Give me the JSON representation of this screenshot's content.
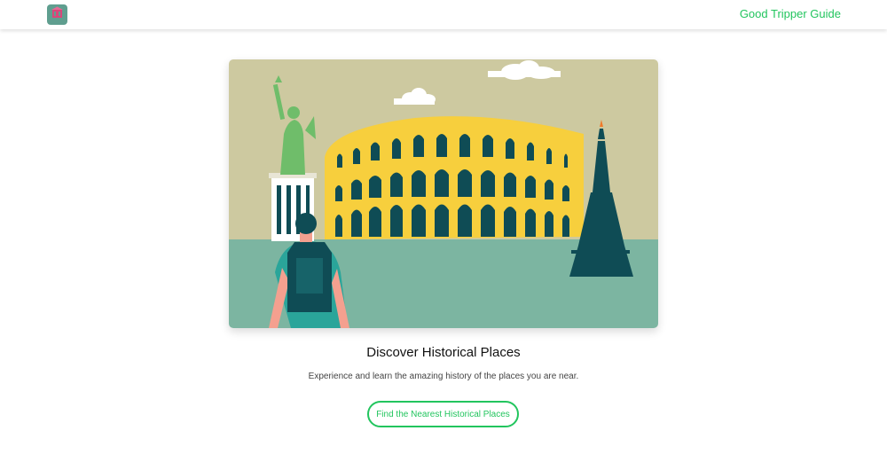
{
  "navbar": {
    "logo_icon": "landmark-logo-icon",
    "brand_label": "Good Tripper Guide"
  },
  "hero": {
    "image_icon": "historical-places-illustration",
    "colors": {
      "sky": "#cdc9a0",
      "ground": "#7cb5a1",
      "colosseum": "#f7cf3d",
      "dark": "#0f4c55",
      "statue": "#6fbd6a",
      "cloud": "#ffffff"
    }
  },
  "main": {
    "title": "Discover Historical Places",
    "subtitle": "Experience and learn the amazing history of the places you are near.",
    "cta_label": "Find the Nearest Historical Places"
  },
  "colors": {
    "accent": "#22c55e"
  }
}
